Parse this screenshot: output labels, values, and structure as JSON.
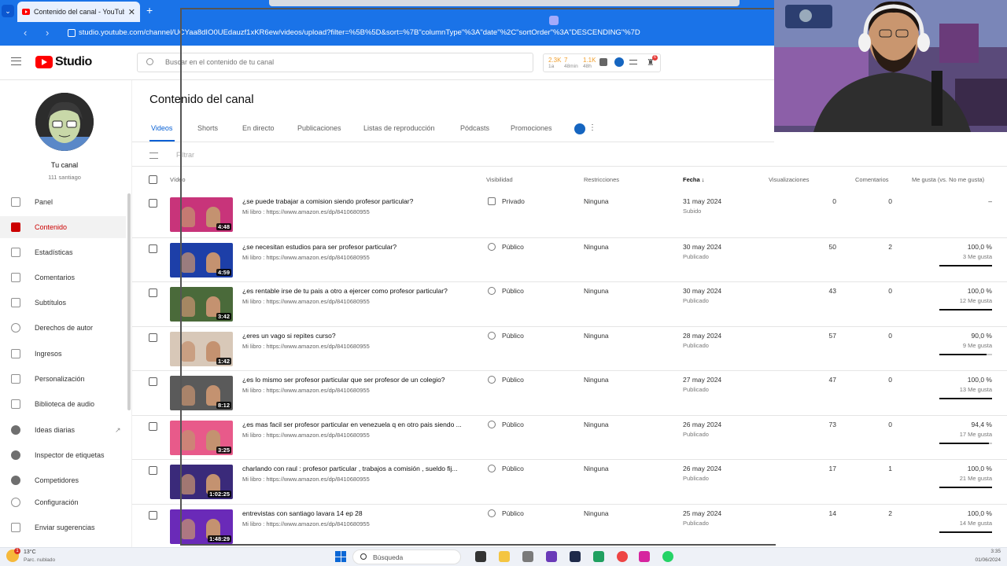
{
  "browser": {
    "tab_title": "Contenido del canal - YouTube",
    "url": "studio.youtube.com/channel/UCYaa8dIO0UEdauzf1xKR6ew/videos/upload?filter=%5B%5D&sort=%7B\"columnType\"%3A\"date\"%2C\"sortOrder\"%3A\"DESCENDING\"%7D"
  },
  "header": {
    "brand": "Studio",
    "search_placeholder": "Buscar en el contenido de tu canal",
    "stats": [
      {
        "value": "2.3K",
        "label": "1a"
      },
      {
        "value": "7",
        "label": "48min"
      },
      {
        "value": "1.1K",
        "label": "48h"
      }
    ],
    "notification_count": "6"
  },
  "sidebar": {
    "channel_label": "Tu canal",
    "channel_name": "111 santiago",
    "items": [
      {
        "label": "Panel",
        "icon": "dashboard-icon"
      },
      {
        "label": "Contenido",
        "icon": "content-icon",
        "active": true
      },
      {
        "label": "Estadísticas",
        "icon": "analytics-icon"
      },
      {
        "label": "Comentarios",
        "icon": "comments-icon"
      },
      {
        "label": "Subtítulos",
        "icon": "subtitles-icon"
      },
      {
        "label": "Derechos de autor",
        "icon": "copyright-icon"
      },
      {
        "label": "Ingresos",
        "icon": "earn-icon"
      },
      {
        "label": "Personalización",
        "icon": "customization-icon"
      },
      {
        "label": "Biblioteca de audio",
        "icon": "audio-library-icon"
      },
      {
        "label": "Ideas diarias",
        "icon": "ideas-icon"
      },
      {
        "label": "Inspector de etiquetas",
        "icon": "tag-inspector-icon"
      },
      {
        "label": "Competidores",
        "icon": "competitors-icon"
      },
      {
        "label": "Configuración",
        "icon": "settings-icon"
      },
      {
        "label": "Enviar sugerencias",
        "icon": "feedback-icon"
      }
    ]
  },
  "main": {
    "title": "Contenido del canal",
    "tabs": [
      "Videos",
      "Shorts",
      "En directo",
      "Publicaciones",
      "Listas de reproducción",
      "Pódcasts",
      "Promociones"
    ],
    "filter_placeholder": "Filtrar",
    "columns": {
      "video": "Vídeo",
      "visibility": "Visibilidad",
      "restrictions": "Restricciones",
      "date": "Fecha",
      "views": "Visualizaciones",
      "comments": "Comentarios",
      "likes": "Me gusta (vs. No me gusta)"
    },
    "videos": [
      {
        "title": "¿se puede trabajar a comision siendo profesor particular?",
        "description": "Mi libro : https://www.amazon.es/dp/8410680955",
        "duration": "4:48",
        "visibility": "Privado",
        "restrictions": "Ninguna",
        "date": "31 may 2024",
        "date_status": "Subido",
        "views": "0",
        "comments": "0",
        "likes_pct": "–",
        "likes_count": "",
        "likes_ratio": 0,
        "thumb_bg": "#c8347a"
      },
      {
        "title": "¿se necesitan estudios para ser profesor particular?",
        "description": "Mi libro : https://www.amazon.es/dp/8410680955",
        "duration": "4:59",
        "visibility": "Público",
        "restrictions": "Ninguna",
        "date": "30 may 2024",
        "date_status": "Publicado",
        "views": "50",
        "comments": "2",
        "likes_pct": "100,0 %",
        "likes_count": "3 Me gusta",
        "likes_ratio": 1.0,
        "thumb_bg": "#1d3fa8"
      },
      {
        "title": "¿es rentable irse de tu pais a otro a ejercer como profesor particular?",
        "description": "Mi libro : https://www.amazon.es/dp/8410680955",
        "duration": "3:42",
        "visibility": "Público",
        "restrictions": "Ninguna",
        "date": "30 may 2024",
        "date_status": "Publicado",
        "views": "43",
        "comments": "0",
        "likes_pct": "100,0 %",
        "likes_count": "12 Me gusta",
        "likes_ratio": 1.0,
        "thumb_bg": "#4a6a3a"
      },
      {
        "title": "¿eres un vago si repites curso?",
        "description": "Mi libro : https://www.amazon.es/dp/8410680955",
        "duration": "1:42",
        "visibility": "Público",
        "restrictions": "Ninguna",
        "date": "28 may 2024",
        "date_status": "Publicado",
        "views": "57",
        "comments": "0",
        "likes_pct": "90,0 %",
        "likes_count": "9 Me gusta",
        "likes_ratio": 0.9,
        "thumb_bg": "#d8c8b8"
      },
      {
        "title": "¿es lo mismo ser profesor particular que ser profesor de un colegio?",
        "description": "Mi libro : https://www.amazon.es/dp/8410680955",
        "duration": "8:12",
        "visibility": "Público",
        "restrictions": "Ninguna",
        "date": "27 may 2024",
        "date_status": "Publicado",
        "views": "47",
        "comments": "0",
        "likes_pct": "100,0 %",
        "likes_count": "13 Me gusta",
        "likes_ratio": 1.0,
        "thumb_bg": "#5a5a5a"
      },
      {
        "title": "¿es mas facil ser profesor particular en venezuela q en otro pais siendo ...",
        "description": "Mi libro : https://www.amazon.es/dp/8410680955",
        "duration": "3:25",
        "visibility": "Público",
        "restrictions": "Ninguna",
        "date": "26 may 2024",
        "date_status": "Publicado",
        "views": "73",
        "comments": "0",
        "likes_pct": "94,4 %",
        "likes_count": "17 Me gusta",
        "likes_ratio": 0.944,
        "thumb_bg": "#e85a8a"
      },
      {
        "title": "charlando con raul : profesor particular , trabajos a comisión , sueldo fij...",
        "description": "Mi libro : https://www.amazon.es/dp/8410680955",
        "duration": "1:02:25",
        "visibility": "Público",
        "restrictions": "Ninguna",
        "date": "26 may 2024",
        "date_status": "Publicado",
        "views": "17",
        "comments": "1",
        "likes_pct": "100,0 %",
        "likes_count": "21 Me gusta",
        "likes_ratio": 1.0,
        "thumb_bg": "#3a2a7a"
      },
      {
        "title": "entrevistas con santiago lavara 14 ep 28",
        "description": "Mi libro : https://www.amazon.es/dp/8410680955",
        "duration": "1:48:29",
        "visibility": "Público",
        "restrictions": "Ninguna",
        "date": "25 may 2024",
        "date_status": "Publicado",
        "views": "14",
        "comments": "2",
        "likes_pct": "100,0 %",
        "likes_count": "14 Me gusta",
        "likes_ratio": 1.0,
        "thumb_bg": "#6a2ab8"
      }
    ]
  },
  "taskbar": {
    "temperature": "13°C",
    "weather": "Parc. nublado",
    "weather_badge": "1",
    "search_label": "Búsqueda",
    "time": "3:35",
    "date": "01/06/2024"
  }
}
